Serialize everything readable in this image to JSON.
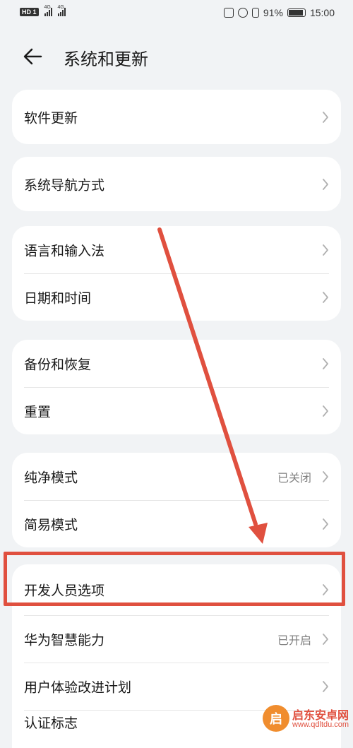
{
  "status_bar": {
    "left_badge": "HD 1",
    "sim1_net": "4G",
    "sim2_net": "4G",
    "battery": "91%",
    "time": "15:00"
  },
  "header": {
    "title": "系统和更新"
  },
  "cards": [
    {
      "rows": [
        {
          "label": "软件更新",
          "value": ""
        }
      ]
    },
    {
      "rows": [
        {
          "label": "系统导航方式",
          "value": ""
        }
      ]
    },
    {
      "rows": [
        {
          "label": "语言和输入法",
          "value": ""
        },
        {
          "label": "日期和时间",
          "value": ""
        }
      ]
    },
    {
      "rows": [
        {
          "label": "备份和恢复",
          "value": ""
        },
        {
          "label": "重置",
          "value": ""
        }
      ]
    },
    {
      "rows": [
        {
          "label": "纯净模式",
          "value": "已关闭"
        },
        {
          "label": "简易模式",
          "value": ""
        }
      ]
    },
    {
      "rows": [
        {
          "label": "开发人员选项",
          "value": ""
        },
        {
          "label": "华为智慧能力",
          "value": "已开启"
        },
        {
          "label": "用户体验改进计划",
          "value": ""
        },
        {
          "label": "认证标志",
          "value": ""
        }
      ]
    }
  ],
  "annotation": {
    "color": "#e0503f"
  },
  "watermark": {
    "logo_glyph": "启",
    "title": "启东安卓网",
    "url": "www.qdltdu.com"
  }
}
